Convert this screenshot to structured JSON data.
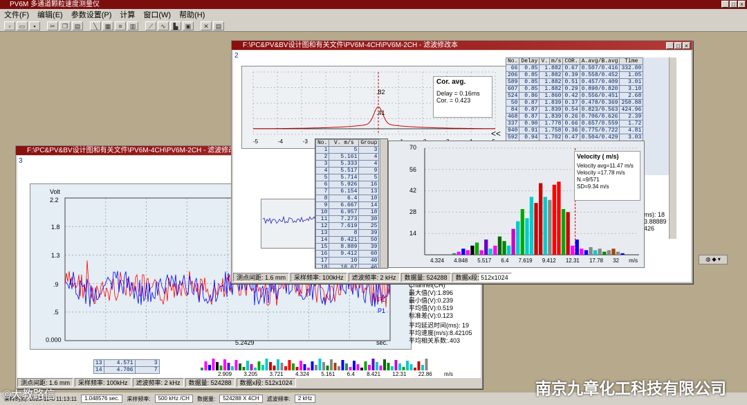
{
  "app": {
    "title": "PV6M 多通道颗粒速度测量仪"
  },
  "menu": [
    "文件(F)",
    "编辑(E)",
    "参数设置(P)",
    "计算",
    "窗口(W)",
    "帮助(H)"
  ],
  "toolbar_icons": [
    "new-icon",
    "open-icon",
    "save-icon",
    "cut-icon",
    "copy-icon",
    "paste-icon",
    "probe-icon",
    "calc-icon",
    "list-icon",
    "grid-icon",
    "line-icon",
    "signal-icon",
    "histogram-icon",
    "plot-icon",
    "close-icon",
    "table-icon"
  ],
  "win_back": {
    "title": "F:\\PC&PV&BV设计图和有关文件\\PV6M-4CH\\PV6M-2CH - 滤波修改本",
    "num": "3",
    "chart": {
      "ylabel": "Volt",
      "xlabel": "sec.",
      "y_ticks": [
        "2.2",
        "1.8",
        "1.3",
        ".9",
        ".5",
        "0.000"
      ],
      "x_tick": "5.2429",
      "legend": [
        "P1",
        "P1"
      ],
      "series_colors": [
        "#ff0000",
        "#0000ff"
      ]
    },
    "stats_right": [
      "Channel(CH)",
      "最大值(V):1.896",
      "最小值(V):0.239",
      "平均值(V):0.519",
      "标准差(V):0.123"
    ],
    "stats_bottom": [
      "平均延迟时间(ms): 19",
      "平均速度(m/s):8.42105",
      "平均相关系数:.403"
    ],
    "table_rows": [
      [
        "13",
        "4.571",
        "3"
      ],
      [
        "14",
        "4.706",
        "7"
      ]
    ],
    "hist_ticks": [
      "2.909",
      "3.205",
      "3.721",
      "4.324",
      "5.161",
      "6.4",
      "8.421",
      "12.31",
      "22.86",
      "m/s"
    ],
    "status": [
      "测点间距: 1.6 mm",
      "采样频率: 100kHz",
      "滤波频率: 2 kHz",
      "数据量: 524288",
      "数据x段: 512x1024"
    ]
  },
  "win_front": {
    "title": "F:\\PC&PV&BV设计图和有关文件\\PV6M-4CH\\PV6M-2CH - 滤波修改本",
    "num": "2",
    "corr": {
      "title": "Cor. avg.",
      "delay": "Delay = 0.16ms",
      "cor": "Cor. = 0.423",
      "peak_labels": [
        ".82",
        ".41"
      ],
      "x_ticks": [
        "-5",
        "-4",
        "-3",
        "-2",
        "-1",
        "0",
        "1",
        "2",
        "3",
        "4",
        "5"
      ],
      "arrow": "<<"
    },
    "right_table": {
      "headers": [
        "No.",
        "Delay",
        "V.",
        "m/s",
        "COR.",
        "A.avg/B.avg",
        "Time"
      ],
      "rows": [
        [
          "66",
          "0.85",
          "1.882",
          "0.67",
          "0.507/0.416",
          "332.80"
        ],
        [
          "206",
          "0.85",
          "1.882",
          "0.39",
          "0.558/0.452",
          "1.05"
        ],
        [
          "589",
          "0.85",
          "1.882",
          "0.51",
          "0.457/0.409",
          "3.01"
        ],
        [
          "607",
          "0.85",
          "1.882",
          "0.29",
          "0.890/0.820",
          "3.10"
        ],
        [
          "524",
          "0.86",
          "1.860",
          "0.42",
          "0.556/0.451",
          "2.68"
        ],
        [
          "50",
          "0.87",
          "1.839",
          "0.37",
          "0.478/0.369",
          "250.88"
        ],
        [
          "84",
          "0.87",
          "1.839",
          "0.54",
          "0.823/0.563",
          "424.96"
        ],
        [
          "468",
          "0.87",
          "1.839",
          "0.26",
          "0.706/0.626",
          "2.39"
        ],
        [
          "337",
          "0.90",
          "1.778",
          "0.66",
          "0.657/0.559",
          "1.72"
        ],
        [
          "940",
          "0.91",
          "1.758",
          "0.36",
          "0.775/0.722",
          "4.81"
        ],
        [
          "592",
          "0.94",
          "1.702",
          "0.47",
          "0.504/0.429",
          "3.03"
        ],
        [
          "611",
          "0.94",
          "1.702",
          "0.40",
          "0.813/0.716",
          "3.12"
        ]
      ],
      "partial_col": [
        ".39",
        ".14",
        ".34",
        ".92",
        ".00",
        ".92",
        ".54",
        ".63",
        ".13"
      ]
    },
    "right_stats": [
      "ms): 18",
      "3.88889",
      "426"
    ],
    "status": [
      "测点间距: 1.6 mm",
      "采样频率: 100kHz",
      "滤波频率: 2 kHz",
      "数据量: 524288",
      "数据x段: 512x1024"
    ]
  },
  "left_table": {
    "headers": [
      "No.",
      "V.",
      "m/s",
      "Group"
    ],
    "rows": [
      [
        "1",
        "5",
        "3"
      ],
      [
        "2",
        "5.161",
        "4"
      ],
      [
        "3",
        "5.333",
        "4"
      ],
      [
        "4",
        "5.517",
        "9"
      ],
      [
        "5",
        "5.714",
        "5"
      ],
      [
        "6",
        "5.926",
        "16"
      ],
      [
        "7",
        "6.154",
        "13"
      ],
      [
        "8",
        "6.4",
        "10"
      ],
      [
        "9",
        "6.667",
        "14"
      ],
      [
        "10",
        "6.957",
        "18"
      ],
      [
        "11",
        "7.273",
        "30"
      ],
      [
        "12",
        "7.619",
        "25"
      ],
      [
        "13",
        "8",
        "39"
      ],
      [
        "14",
        "8.421",
        "50"
      ],
      [
        "15",
        "8.889",
        "39"
      ],
      [
        "16",
        "9.412",
        "60"
      ],
      [
        "17",
        "10",
        "40"
      ],
      [
        "18",
        "10.67",
        "46"
      ]
    ]
  },
  "velocity": {
    "title": "Velocity ( m/s)",
    "lines": [
      "Velocity avg=11.47 m/s",
      "Velocity =17.78 m/s",
      "N.=9/571",
      "SD=9.34 m/s"
    ],
    "y_ticks": [
      "70",
      "56",
      "42",
      "28",
      "14"
    ],
    "x_ticks": [
      "4.324",
      "4.848",
      "5.517",
      "6.4",
      "7.619",
      "9.412",
      "12.31",
      "17.78",
      "32",
      "m/s"
    ]
  },
  "chart_data": {
    "type": "bar",
    "title": "Velocity ( m/s)",
    "xlabel": "m/s",
    "ylim": [
      0,
      70
    ],
    "values": [
      1,
      2,
      4,
      3,
      6,
      8,
      3,
      10,
      4,
      6,
      12,
      9,
      6,
      17,
      22,
      30,
      24,
      38,
      34,
      47,
      38,
      36,
      46,
      48,
      30,
      28,
      6,
      10,
      4,
      3,
      5,
      3,
      4,
      2,
      3,
      4,
      2,
      1
    ],
    "colors": [
      "#2e8b57",
      "#ff00ff",
      "#0000ff",
      "#ff00ff",
      "#000000",
      "#00aa00",
      "#ff00ff",
      "#6600cc",
      "#00cccc",
      "#ff00ff",
      "#006600",
      "#008800",
      "#00cccc",
      "#cc00cc",
      "#00cccc",
      "#00aa00",
      "#00cccc",
      "#00cccc",
      "#cc0000",
      "#cc0000",
      "#00cccc",
      "#888888",
      "#ff0000",
      "#ff0000",
      "#00aa00",
      "#cc0000",
      "#ff00ff",
      "#0000ff",
      "#ff00ff",
      "#0000ff",
      "#888888",
      "#00cccc",
      "#888888",
      "#008800",
      "#888888",
      "#aa4400",
      "#888888",
      "#0000ff"
    ]
  },
  "bottom": {
    "fields": [
      "采样时间: 2023-12-6 11:13:11",
      "1.048576 sec.",
      "采样频率:",
      "500 kHz /CH",
      "数据量:",
      "524288 X 4CH",
      "滤波频率:",
      "2 kHz"
    ]
  },
  "watermark": {
    "company": "南京九章化工科技有限公司",
    "wechat": "©大教路信"
  }
}
